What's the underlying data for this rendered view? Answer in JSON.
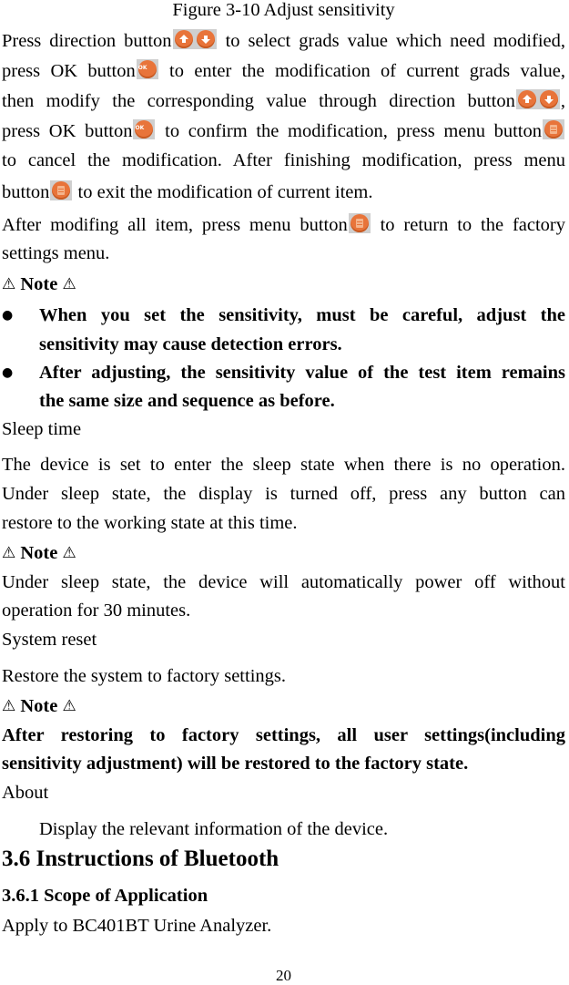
{
  "figure_caption": "Figure 3-10 Adjust sensitivity",
  "adjust_paragraph": {
    "l1a": "Press direction button",
    "l1b": " to select grads value which need modified,",
    "l2a": "press OK button",
    "l2b": " to enter the modification of current grads value,",
    "l3a": "then modify the corresponding value through direction button",
    "l3b": ",",
    "l4a": "press OK button",
    "l4b": " to confirm the modification, press menu button",
    "l5": "to cancel the modification. After finishing modification, press menu",
    "l6a": "button",
    "l6b": " to exit the modification of current item."
  },
  "after_paragraph": {
    "l1a": "After modifing all item, press menu button",
    "l1b": " to return to the factory",
    "l2": "settings menu."
  },
  "note_label": "Note",
  "note1_bullets": [
    {
      "l1": "When you set the sensitivity, must be careful, adjust the",
      "l2": "sensitivity may cause detection errors."
    },
    {
      "l1": "After adjusting, the sensitivity value of the test item remains",
      "l2": "the same size and sequence as before."
    }
  ],
  "sleep": {
    "title": "Sleep time",
    "l1": "The device is set to enter the sleep state when there is no operation.",
    "l2": "Under sleep state, the display is turned off, press any button can",
    "l3": "restore to the working state at this time.",
    "note_l1": "Under sleep state, the device will automatically power off without",
    "note_l2": "operation for 30 minutes."
  },
  "reset": {
    "title": "System reset",
    "l1": "Restore the system to factory settings.",
    "note_l1": "After restoring to factory settings, all user settings(including",
    "note_l2": "sensitivity adjustment) will be restored to the factory state."
  },
  "about": {
    "title": "About",
    "l1": "Display the relevant information of the device."
  },
  "section_heading": "3.6 Instructions of Bluetooth",
  "subsection_heading": "3.6.1 Scope of Application",
  "scope_text": "Apply to BC401BT Urine Analyzer.",
  "page_number": "20",
  "icons": {
    "direction": "up-down-arrow-buttons",
    "ok": "ok-button",
    "menu": "menu-button",
    "warning": "warning-triangle",
    "ok_label": "OK",
    "warning_glyph": "⚠",
    "bullet_glyph": "●"
  },
  "colors": {
    "button_orange": "#e8743a",
    "icon_bg": "#cfcfcf"
  }
}
